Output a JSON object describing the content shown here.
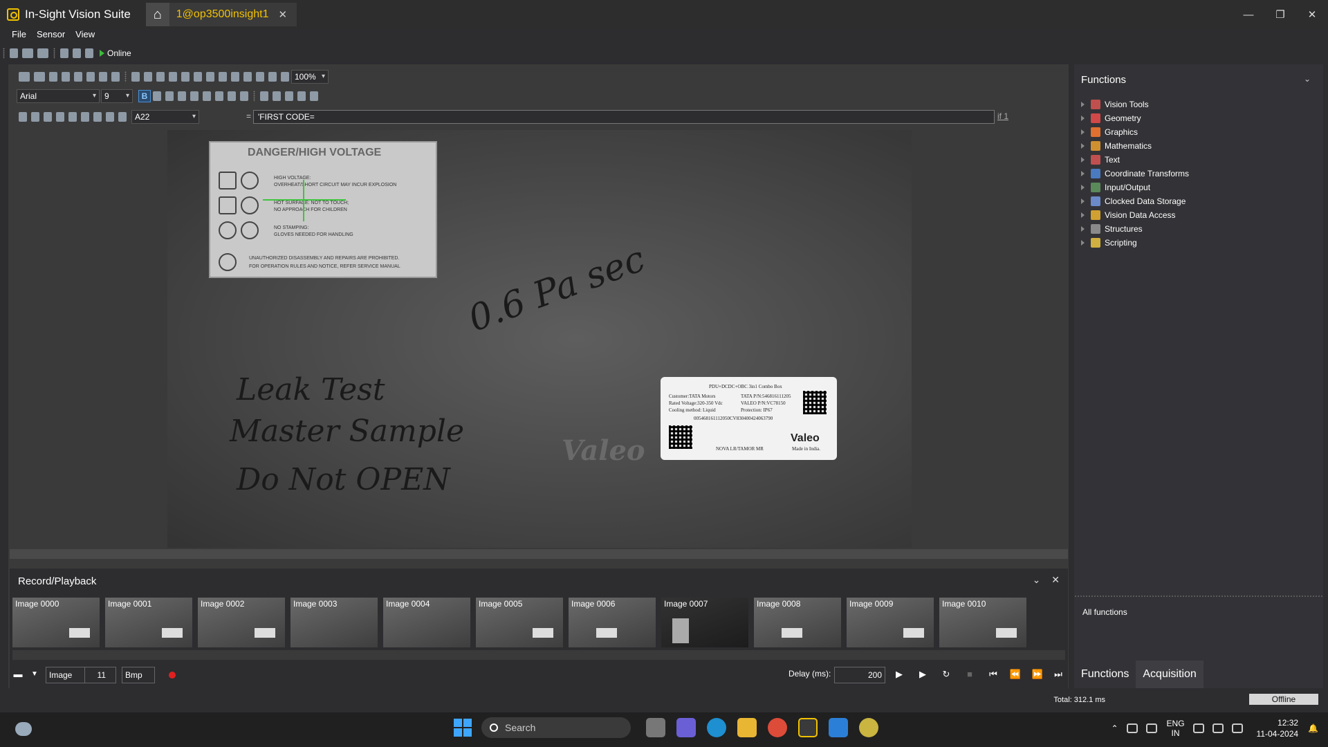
{
  "app": {
    "title": "In-Sight Vision Suite",
    "doc_tab": "1@op3500insight1",
    "window_controls": [
      "—",
      "❐",
      "✕"
    ]
  },
  "menu": [
    "File",
    "Sensor",
    "View"
  ],
  "toolbar": {
    "online_label": "Online"
  },
  "spreadsheet": {
    "zoom": "100%",
    "font": "Arial",
    "font_size": "9",
    "bold_label": "B",
    "cell_ref": "A22",
    "formula": "'FIRST  CODE=",
    "if_link": "if 1"
  },
  "image": {
    "warning_title": "DANGER/HIGH VOLTAGE",
    "warning_lines": [
      "HIGH VOLTAGE:",
      "OVERHEAT/SHORT CIRCUIT MAY INCUR EXPLOSION",
      "HOT SURFACE: NOT TO TOUCH;",
      "NO APPROACH FOR CHILDREN",
      "NO STAMPING:",
      "GLOVES NEEDED FOR HANDLING",
      "UNAUTHORIZED DISASSEMBLY AND REPAIRS ARE PROHIBITED.",
      "FOR OPERATION RULES AND NOTICE, REFER SERVICE MANUAL"
    ],
    "sticker_lines": [
      "PDU+DCDC+OBC 3in1 Combo Box",
      "Customer:TATA Motors",
      "TATA P/N:546816111205",
      "Rated Voltage:320-350 Vdc",
      "VALEO P/N:VC78150",
      "Cooling method: Liquid",
      "Protection: IP67",
      "005468161112050CV830400424063790",
      "NOVA LR/TAMOR MR",
      "Valeo",
      "Made in India."
    ],
    "handwriting": [
      "0.6 Pa sec",
      "Leak Test",
      "Master Sample",
      "Do Not OPEN",
      "Valeo"
    ]
  },
  "record_playback": {
    "title": "Record/Playback",
    "thumbnails": [
      "Image 0000",
      "Image 0001",
      "Image 0002",
      "Image 0003",
      "Image 0004",
      "Image 0005",
      "Image 0006",
      "Image 0007",
      "Image 0008",
      "Image 0009",
      "Image 0010"
    ],
    "source_label": "Image",
    "count": "11",
    "format": "Bmp",
    "delay_label": "Delay (ms):",
    "delay_value": "200"
  },
  "functions": {
    "header": "Functions",
    "items": [
      {
        "label": "Vision Tools",
        "color": "#c0504d"
      },
      {
        "label": "Geometry",
        "color": "#d04848"
      },
      {
        "label": "Graphics",
        "color": "#e07030"
      },
      {
        "label": "Mathematics",
        "color": "#d09030"
      },
      {
        "label": "Text",
        "color": "#c05050"
      },
      {
        "label": "Coordinate Transforms",
        "color": "#4a7ac0"
      },
      {
        "label": "Input/Output",
        "color": "#5a8a5a"
      },
      {
        "label": "Clocked Data Storage",
        "color": "#6a8ac8"
      },
      {
        "label": "Vision Data Access",
        "color": "#d0a030"
      },
      {
        "label": "Structures",
        "color": "#8a8a8a"
      },
      {
        "label": "Scripting",
        "color": "#d0b040"
      }
    ],
    "all_functions": "All functions",
    "tabs": [
      "Functions",
      "Acquisition"
    ]
  },
  "status": {
    "total": "Total: 312.1 ms",
    "mode": "Offline"
  },
  "taskbar": {
    "search_placeholder": "Search",
    "lang_top": "ENG",
    "lang_bottom": "IN",
    "time": "12:32",
    "date": "11-04-2024"
  }
}
